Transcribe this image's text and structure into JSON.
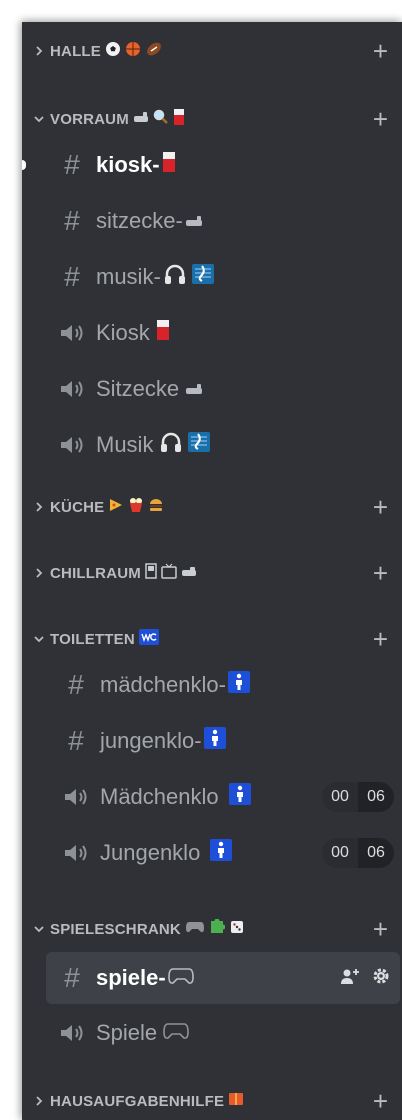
{
  "categories": {
    "halle": {
      "label": "HALLE",
      "add": "+"
    },
    "vorraum": {
      "label": "VORRAUM",
      "add": "+"
    },
    "kueche": {
      "label": "KÜCHE",
      "add": "+"
    },
    "chillraum": {
      "label": "CHILLRAUM",
      "add": "+"
    },
    "toiletten": {
      "label": "TOILETTEN",
      "add": "+"
    },
    "spieleschrank": {
      "label": "SPIELESCHRANK",
      "add": "+"
    },
    "hausaufgabenhilfe": {
      "label": "HAUSAUFGABENHILFE",
      "add": "+"
    }
  },
  "channels": {
    "kiosk_text": {
      "label": "kiosk-"
    },
    "sitzecke_text": {
      "label": "sitzecke-"
    },
    "musik_text": {
      "label": "musik-"
    },
    "kiosk_voice": {
      "label": "Kiosk"
    },
    "sitzecke_voice": {
      "label": "Sitzecke"
    },
    "musik_voice": {
      "label": "Musik"
    },
    "maedchenklo_text": {
      "label": "mädchenklo-"
    },
    "jungenklo_text": {
      "label": "jungenklo-"
    },
    "maedchenklo_voice": {
      "label": "Mädchenklo",
      "count_left": "00",
      "count_right": "06"
    },
    "jungenklo_voice": {
      "label": "Jungenklo",
      "count_left": "00",
      "count_right": "06"
    },
    "spiele_text": {
      "label": "spiele-"
    },
    "spiele_voice": {
      "label": "Spiele"
    }
  },
  "icons": {
    "text_channel": "hash-icon",
    "voice_channel": "speaker-icon",
    "add": "plus-icon",
    "invite": "add-member-icon",
    "settings": "gear-icon"
  },
  "colors": {
    "sidebar_bg": "#2f3136",
    "text_muted": "#a3a6aa",
    "text_active": "#ffffff",
    "selected_bg": "#3e4148",
    "wc_badge": "#1e4fd8"
  }
}
